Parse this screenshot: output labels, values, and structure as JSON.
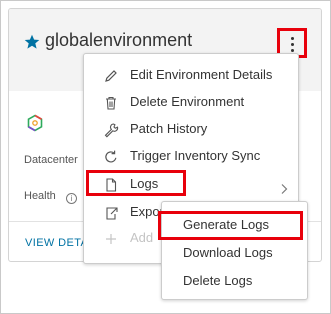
{
  "card": {
    "title": "globalenvironment",
    "fields": {
      "datacenter_label": "Datacenter",
      "health_label": "Health",
      "info_icon": "i"
    },
    "view_details": "VIEW DETAILS"
  },
  "menu": {
    "items": [
      {
        "label": "Edit Environment Details",
        "icon": "pencil-icon",
        "disabled": false
      },
      {
        "label": "Delete Environment",
        "icon": "trash-icon",
        "disabled": false
      },
      {
        "label": "Patch History",
        "icon": "wrench-icon",
        "disabled": false
      },
      {
        "label": "Trigger Inventory Sync",
        "icon": "refresh-icon",
        "disabled": false
      },
      {
        "label": "Logs",
        "icon": "file-icon",
        "disabled": false,
        "has_submenu": true
      },
      {
        "label": "Export",
        "icon": "export-icon",
        "disabled": false
      },
      {
        "label": "Add",
        "icon": "plus-icon",
        "disabled": true
      }
    ]
  },
  "submenu": {
    "items": [
      {
        "label": "Generate Logs"
      },
      {
        "label": "Download Logs"
      },
      {
        "label": "Delete Logs"
      }
    ]
  },
  "colors": {
    "highlight": "#e8000b",
    "star": "#0072a3",
    "link": "#0072a3",
    "header_bg": "#f3f3f3"
  }
}
